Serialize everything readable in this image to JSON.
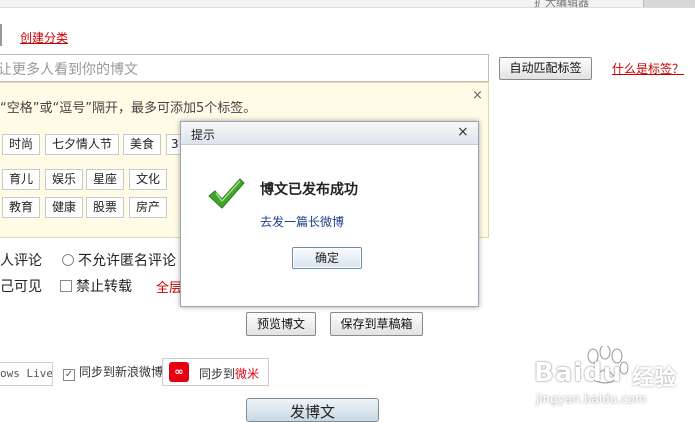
{
  "topbar": {
    "text": "扩大编辑器"
  },
  "category": {
    "create_link": "创建分类"
  },
  "tags": {
    "placeholder": "让更多人看到你的博文",
    "auto_match_button": "自动匹配标签",
    "what_is_tag_link": "什么是标签？",
    "hint": "“空格”或“逗号”隔开，最多可添加5个标签。",
    "close": "×",
    "chips_row1": [
      "时尚",
      "七夕情人节",
      "美食",
      "3"
    ],
    "chips_row2": [
      "育儿",
      "娱乐",
      "星座",
      "文化"
    ],
    "chips_row3": [
      "教育",
      "健康",
      "股票",
      "房产"
    ]
  },
  "options": {
    "comment_all_fragment": "人评论",
    "no_anonymous_comment": "不允许匿名评论",
    "self_visible_fragment": "己可见",
    "no_repost": "禁止转载",
    "red_fragment": "全层"
  },
  "actions": {
    "preview_button": "预览博文",
    "save_draft_button": "保存到草稿箱"
  },
  "sync": {
    "live_fragment": "ows Live",
    "sina_label": "同步到新浪微博",
    "weimi_prefix": "同步到",
    "weimi_accent": "微米",
    "weimi_logo": "∞"
  },
  "publish_button": "发博文",
  "watermark": {
    "brand": "Baidu",
    "jingyan": "经验",
    "url": "jingyan.baidu.com"
  },
  "dialog": {
    "title": "提示",
    "close": "×",
    "message": "博文已发布成功",
    "sub_link": "去发一篇长微博",
    "ok_button": "确定"
  },
  "colors": {
    "link_red": "#cc0000",
    "modal_link_blue": "#1f3f8f",
    "suggest_bg": "#fffbe6",
    "check_green": "#3fa52c"
  }
}
